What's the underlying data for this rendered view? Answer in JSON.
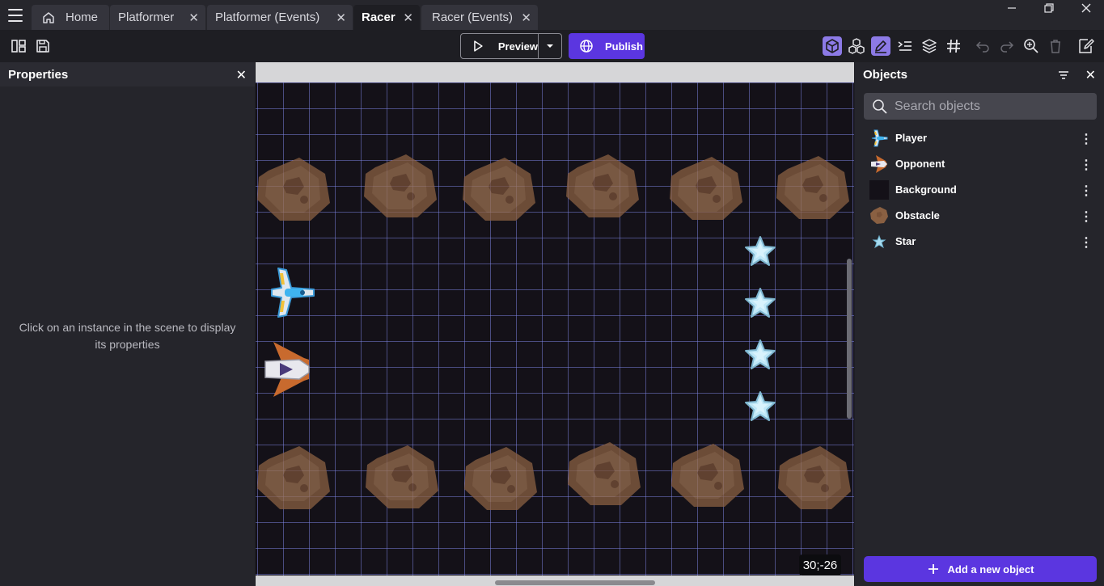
{
  "tabs": [
    {
      "label": "Home",
      "closable": false
    },
    {
      "label": "Platformer",
      "closable": true
    },
    {
      "label": "Platformer (Events)",
      "closable": true
    },
    {
      "label": "Racer",
      "closable": true,
      "active": true
    },
    {
      "label": "Racer (Events)",
      "closable": true
    }
  ],
  "toolbar": {
    "preview_label": "Preview",
    "publish_label": "Publish"
  },
  "properties": {
    "title": "Properties",
    "empty_message": "Click on an instance in the scene to display its properties"
  },
  "scene": {
    "coordinates": "30;-26"
  },
  "objects": {
    "title": "Objects",
    "search_placeholder": "Search objects",
    "items": [
      {
        "name": "Player",
        "icon": "spaceship-icon"
      },
      {
        "name": "Opponent",
        "icon": "opponent-ship-icon"
      },
      {
        "name": "Background",
        "icon": "background-swatch-icon"
      },
      {
        "name": "Obstacle",
        "icon": "asteroid-icon"
      },
      {
        "name": "Star",
        "icon": "star-icon"
      }
    ],
    "add_label": "Add a new object"
  },
  "colors": {
    "accent": "#5b36e0",
    "selected_tool": "#8c7ae6",
    "grid_line": "#7f86e8",
    "scene_bg": "#141118",
    "asteroid": "#8a6042",
    "star": "#a8dcf0"
  }
}
